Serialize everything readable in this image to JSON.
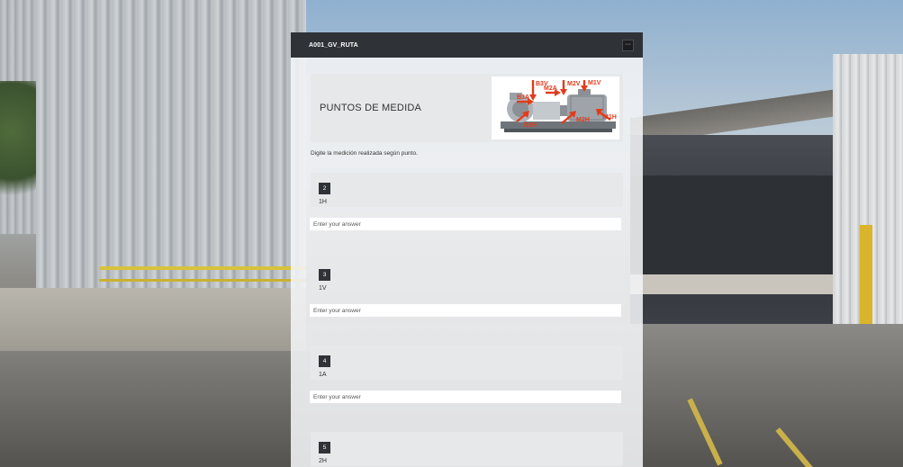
{
  "form": {
    "title": "A001_GV_RUTA",
    "more_label": "···",
    "section_title": "PUNTOS DE MEDIDA",
    "description": "Digite la medición realizada según punto.",
    "image_labels": [
      "B3V",
      "M2V",
      "M1V",
      "B3A",
      "M2A",
      "B3H",
      "M2H",
      "M1H"
    ],
    "answer_placeholder": "Enter your answer",
    "questions": [
      {
        "number": "2",
        "label": "1H"
      },
      {
        "number": "3",
        "label": "1V"
      },
      {
        "number": "4",
        "label": "1A"
      },
      {
        "number": "5",
        "label": "2H"
      }
    ]
  },
  "colors": {
    "header_bg": "#2f3236",
    "card_bg": "#f3f4f6",
    "question_bg": "#e6e8ea",
    "arrow_red": "#e23b1c"
  }
}
